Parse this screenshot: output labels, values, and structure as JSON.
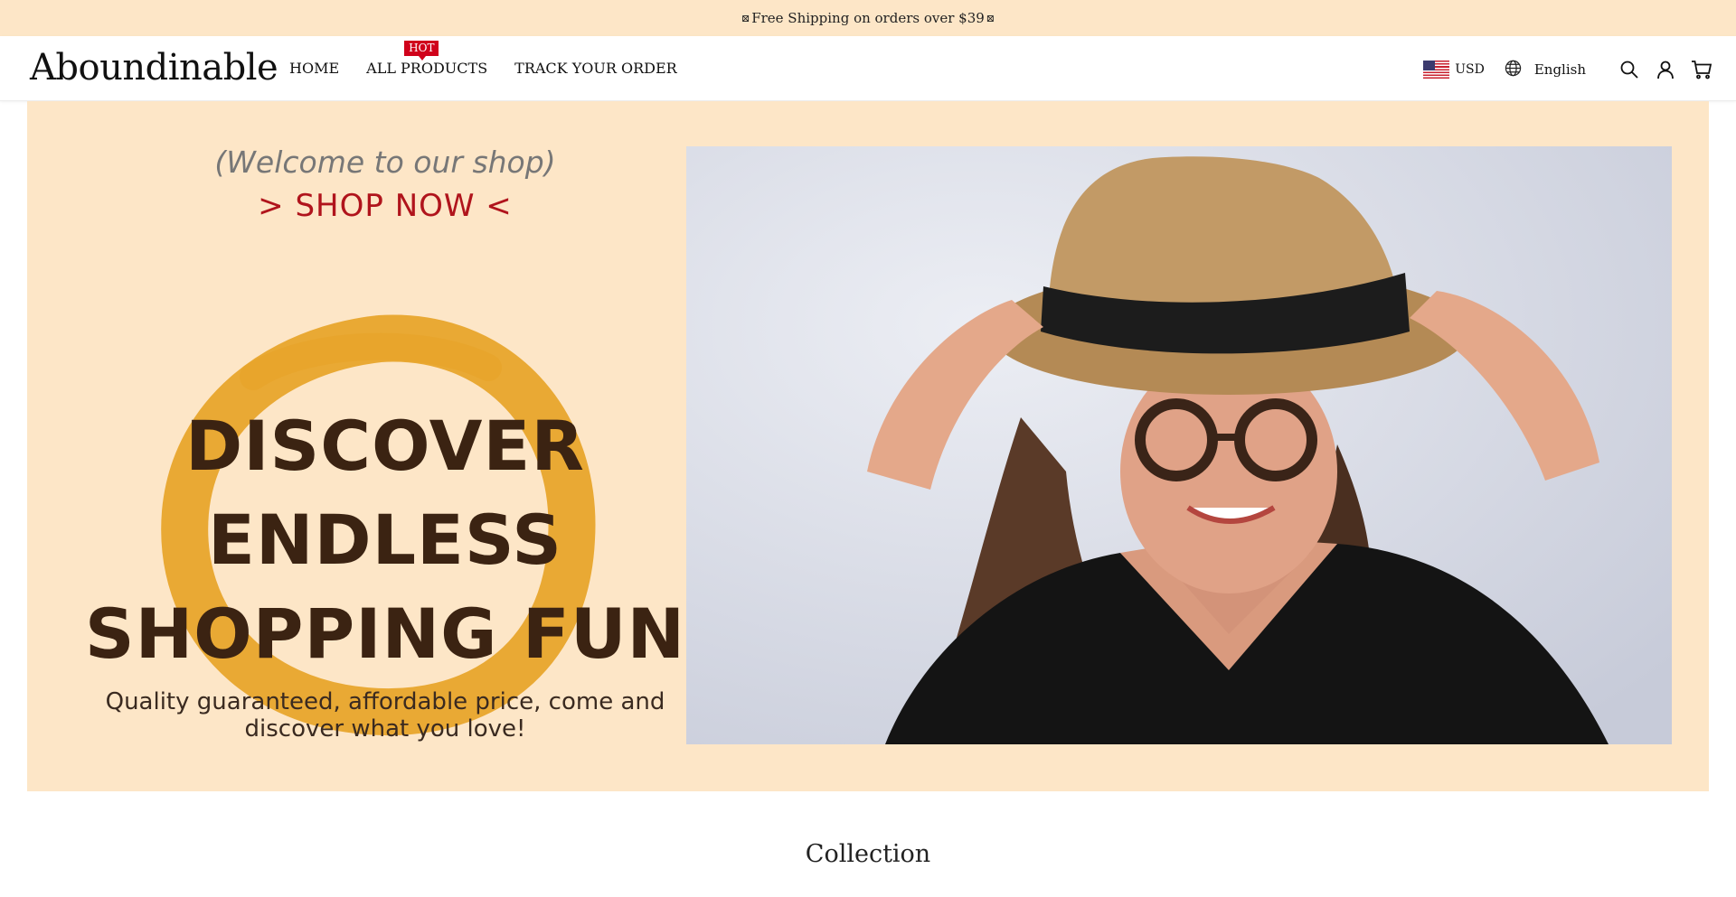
{
  "announcement": {
    "text": "Free Shipping on orders over $39",
    "marker": "⊠"
  },
  "header": {
    "logo": "Aboundinable",
    "nav": [
      {
        "label": "HOME"
      },
      {
        "label": "ALL PRODUCTS",
        "badge": "HOT"
      },
      {
        "label": "TRACK YOUR ORDER"
      }
    ],
    "currency": "USD",
    "language": "English",
    "icons": [
      "globe-icon",
      "search-icon",
      "user-icon",
      "cart-icon"
    ]
  },
  "hero": {
    "welcome": "(Welcome to our shop)",
    "shop_now": "> SHOP NOW  <",
    "headline": [
      "DISCOVER",
      "ENDLESS",
      "SHOPPING FUN"
    ],
    "subtext": [
      "Quality guaranteed, affordable price, come and",
      "discover what you love!"
    ],
    "colors": {
      "background": "#fde6c7",
      "accent": "#b0141c",
      "ring": "#e8a52c",
      "headline": "#3b2312"
    }
  },
  "collection": {
    "title": "Collection"
  }
}
